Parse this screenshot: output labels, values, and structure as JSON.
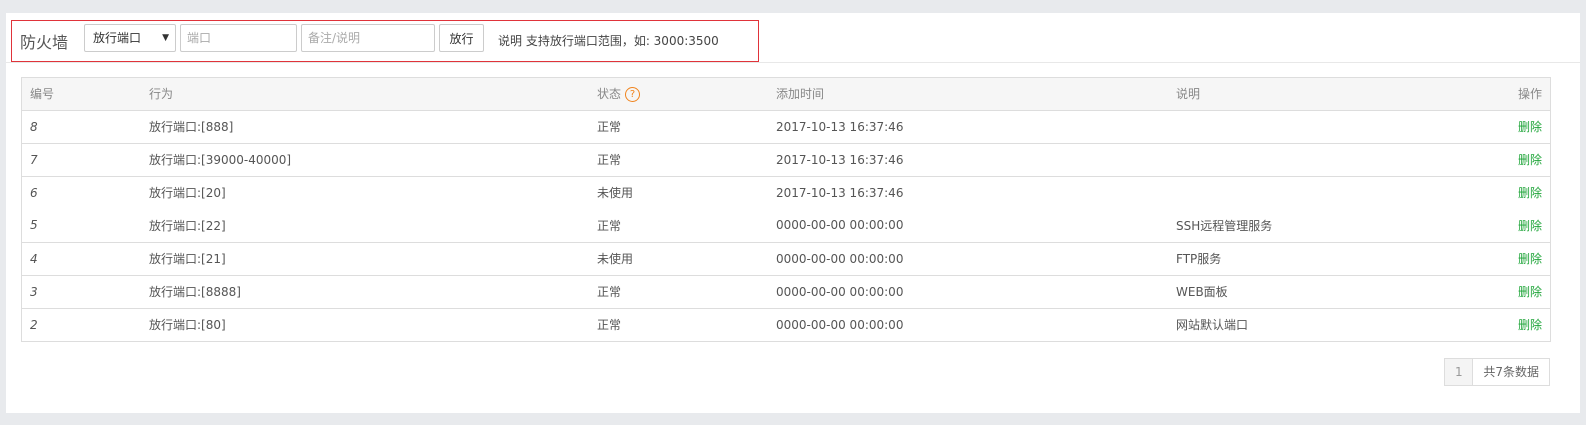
{
  "toolbar": {
    "title": "防火墙",
    "select_value": "放行端口",
    "port_placeholder": "端口",
    "note_placeholder": "备注/说明",
    "allow_label": "放行",
    "hint": "说明  支持放行端口范围，如: 3000:3500"
  },
  "table": {
    "headers": {
      "id": "编号",
      "action": "行为",
      "status": "状态",
      "time": "添加时间",
      "desc": "说明",
      "op": "操作"
    },
    "help_glyph": "?",
    "delete_label": "删除",
    "rows": [
      {
        "id": "8",
        "action": "放行端口:[888]",
        "status": "正常",
        "time": "2017-10-13 16:37:46",
        "desc": ""
      },
      {
        "id": "7",
        "action": "放行端口:[39000-40000]",
        "status": "正常",
        "time": "2017-10-13 16:37:46",
        "desc": ""
      },
      {
        "id": "6",
        "action": "放行端口:[20]",
        "status": "未使用",
        "time": "2017-10-13 16:37:46",
        "desc": ""
      },
      {
        "id": "5",
        "action": "放行端口:[22]",
        "status": "正常",
        "time": "0000-00-00 00:00:00",
        "desc": "SSH远程管理服务"
      },
      {
        "id": "4",
        "action": "放行端口:[21]",
        "status": "未使用",
        "time": "0000-00-00 00:00:00",
        "desc": "FTP服务"
      },
      {
        "id": "3",
        "action": "放行端口:[8888]",
        "status": "正常",
        "time": "0000-00-00 00:00:00",
        "desc": "WEB面板"
      },
      {
        "id": "2",
        "action": "放行端口:[80]",
        "status": "正常",
        "time": "0000-00-00 00:00:00",
        "desc": "网站默认端口"
      }
    ]
  },
  "pager": {
    "current": "1",
    "total": "共7条数据"
  }
}
